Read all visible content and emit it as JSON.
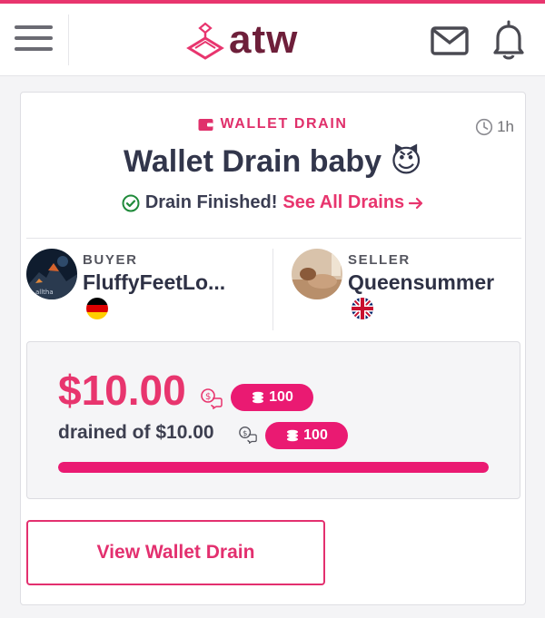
{
  "header": {
    "logo_text": "atw",
    "brand_color": "#e8356e",
    "icons": [
      "menu-icon",
      "hanger-logo-icon",
      "mail-icon",
      "bell-icon"
    ]
  },
  "card": {
    "type_label": "WALLET DRAIN",
    "time_ago": "1h",
    "title": "Wallet Drain baby 😈",
    "status_text": "Drain Finished!",
    "see_all_label": "See All Drains",
    "buyer": {
      "role": "BUYER",
      "name": "FluffyFeetLo...",
      "avatar_caption": "alltha",
      "flag": "germany-flag-icon"
    },
    "seller": {
      "role": "SELLER",
      "name": "Queensummer",
      "flag": "uk-flag-icon"
    },
    "amount": "$10.00",
    "amount_tokens": "100",
    "drained_text": "drained of $10.00",
    "goal_tokens": "100",
    "progress_fraction": 1.0,
    "view_button_label": "View Wallet Drain"
  }
}
